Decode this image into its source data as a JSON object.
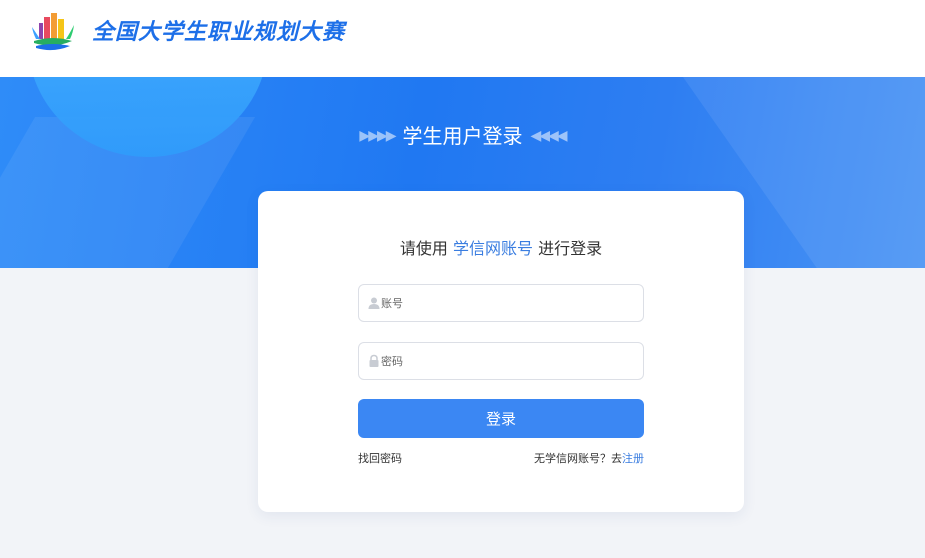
{
  "header": {
    "site_title": "全国大学生职业规划大赛"
  },
  "banner": {
    "arrows_left": "▶▶▶▶",
    "title": "学生用户登录",
    "arrows_right": "◀◀◀◀"
  },
  "login": {
    "heading_prefix": "请使用",
    "heading_highlight": "学信网账号",
    "heading_suffix": "进行登录",
    "account_placeholder": "账号",
    "password_placeholder": "密码",
    "submit_label": "登录",
    "forgot_label": "找回密码",
    "no_account_text": "无学信网账号？去",
    "register_label": "注册"
  },
  "colors": {
    "brand_blue": "#1d6fe8",
    "button_blue": "#3b87f3",
    "link_blue": "#3a7de0",
    "page_bg": "#f2f4f8"
  },
  "icons": {
    "account_field": "user-icon",
    "password_field": "lock-icon"
  }
}
